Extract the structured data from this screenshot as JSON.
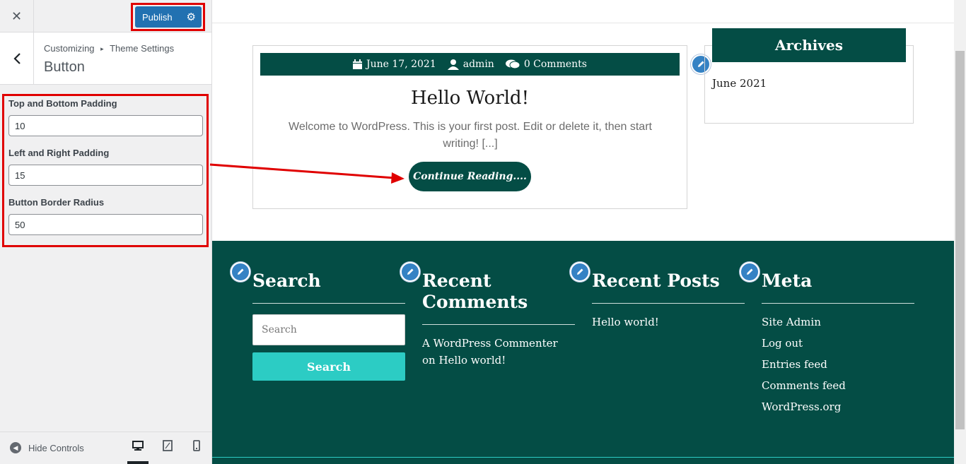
{
  "customizer": {
    "publish_label": "Publish",
    "breadcrumb_root": "Customizing",
    "breadcrumb_sep": "▸",
    "breadcrumb_parent": "Theme Settings",
    "section_title": "Button",
    "controls": [
      {
        "label": "Top and Bottom Padding",
        "value": "10"
      },
      {
        "label": "Left and Right Padding",
        "value": "15"
      },
      {
        "label": "Button Border Radius",
        "value": "50"
      }
    ],
    "hide_controls": "Hide Controls",
    "devices": [
      "desktop-icon",
      "tablet-icon",
      "mobile-icon"
    ],
    "active_device": "desktop"
  },
  "post": {
    "date": "June 17, 2021",
    "author": "admin",
    "comments": "0 Comments",
    "title": "Hello World!",
    "excerpt": "Welcome to WordPress. This is your first post. Edit or delete it, then start writing! [...]",
    "button": "Continue Reading...."
  },
  "archives": {
    "title": "Archives",
    "items": [
      "June 2021"
    ]
  },
  "footer": {
    "search": {
      "title": "Search",
      "placeholder": "Search",
      "button": "Search"
    },
    "recent_comments": {
      "title_line1": "Recent",
      "title_line2": "Comments",
      "item_line1": "A WordPress Commenter",
      "item_line2": "on Hello world!"
    },
    "recent_posts": {
      "title": "Recent Posts",
      "items": [
        "Hello world!"
      ]
    },
    "meta": {
      "title": "Meta",
      "items": [
        "Site Admin",
        "Log out",
        "Entries feed",
        "Comments feed",
        "WordPress.org"
      ]
    }
  },
  "colors": {
    "brand_green": "#044d45",
    "accent_teal": "#2cccc4",
    "wp_blue": "#2271b1",
    "annotation_red": "#e00000"
  }
}
